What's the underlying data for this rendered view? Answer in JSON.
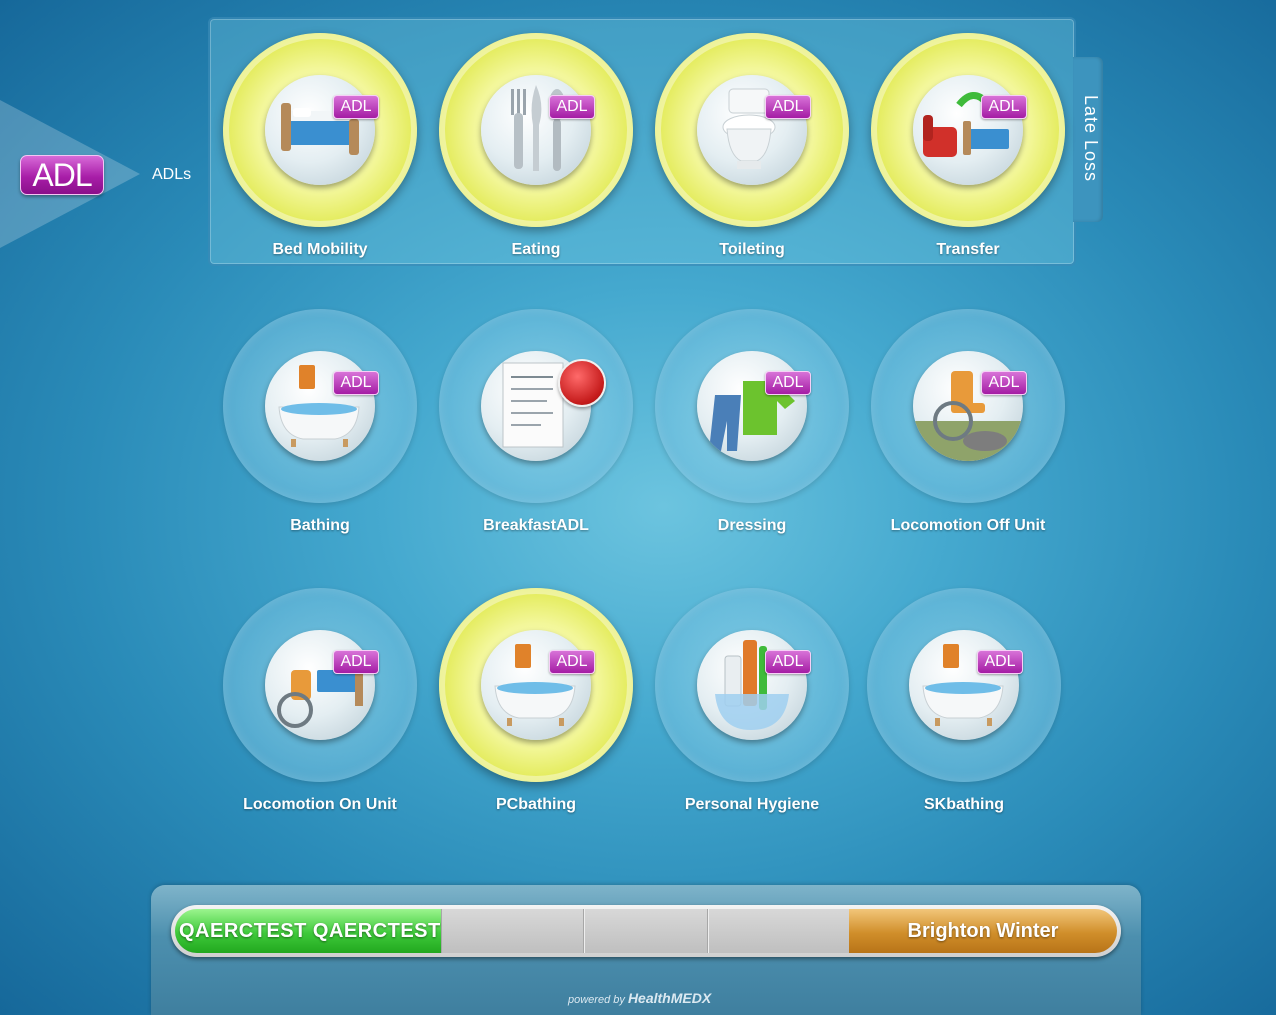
{
  "section": {
    "badge": "ADL",
    "label": "ADLs"
  },
  "group_tab": "Late Loss",
  "tile_badge": "ADL",
  "tiles": [
    {
      "label": "Bed Mobility",
      "icon": "bed-icon",
      "active": true
    },
    {
      "label": "Eating",
      "icon": "fork-knife-icon",
      "active": true
    },
    {
      "label": "Toileting",
      "icon": "toilet-icon",
      "active": true
    },
    {
      "label": "Transfer",
      "icon": "chair-bed-transfer-icon",
      "active": true
    },
    {
      "label": "Bathing",
      "icon": "bathtub-icon",
      "active": false
    },
    {
      "label": "BreakfastADL",
      "icon": "form-heart-icon",
      "active": false
    },
    {
      "label": "Dressing",
      "icon": "clothes-icon",
      "active": false
    },
    {
      "label": "Locomotion Off Unit",
      "icon": "wheelchair-outdoor-icon",
      "active": false
    },
    {
      "label": "Locomotion On Unit",
      "icon": "wheelchair-bed-icon",
      "active": false
    },
    {
      "label": "PCbathing",
      "icon": "bathtub-icon",
      "active": true
    },
    {
      "label": "Personal Hygiene",
      "icon": "toothbrush-comb-icon",
      "active": false
    },
    {
      "label": "SKbathing",
      "icon": "bathtub-icon",
      "active": false
    }
  ],
  "footer": {
    "resident": "QAERCTEST QAERCTEST",
    "facility": "Brighton Winter",
    "home_icon": "home-icon",
    "powered_by": "powered by",
    "brand": "HealthMEDX"
  },
  "colors": {
    "active_ring": "#dfe84a",
    "badge": "#a41ca4",
    "resident_bar": "#3ec93a",
    "facility_bar": "#d08e2a"
  }
}
